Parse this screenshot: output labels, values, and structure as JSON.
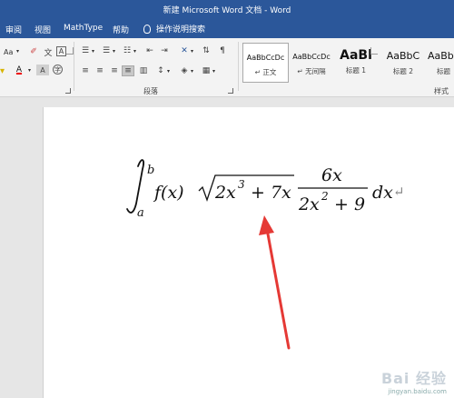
{
  "window": {
    "title": "新建 Microsoft Word 文档 - Word"
  },
  "tabs": [
    {
      "label": "审阅"
    },
    {
      "label": "视图"
    },
    {
      "label": "MathType"
    },
    {
      "label": "帮助"
    }
  ],
  "tell_me": {
    "label": "操作说明搜索"
  },
  "ribbon": {
    "font_group": {
      "font_size_label": "Aa",
      "wen_label": "文",
      "a_label": "A"
    },
    "paragraph_group": {
      "label": "段落"
    },
    "styles_group": {
      "label": "样式"
    },
    "styles": [
      {
        "sample": "AaBbCcDc",
        "name": "↵ 正文",
        "selected": true
      },
      {
        "sample": "AaBbCcDc",
        "name": "↵ 无间隔",
        "selected": false
      },
      {
        "sample": "AaBl",
        "name": "标题 1",
        "selected": false
      },
      {
        "sample": "AaBbC",
        "name": "标题 2",
        "selected": false
      },
      {
        "sample": "AaBb",
        "name": "标题",
        "selected": false
      }
    ]
  },
  "equation": {
    "integral_lower": "a",
    "integral_upper": "b",
    "fx": "f(x)",
    "radicand_2": "2",
    "radicand_x": "x",
    "radicand_exp": "3",
    "radicand_rest": "+ 7x",
    "numerator": "6x",
    "denominator_2": "2",
    "denominator_x": "x",
    "denominator_exp": "2",
    "denominator_rest": "+ 9",
    "dx": "dx",
    "paragraph_mark": "↵"
  },
  "annotation": {
    "arrow_color": "#e53935"
  },
  "watermark": {
    "logo": "Bai 经验",
    "url": "jingyan.baidu.com"
  },
  "colors": {
    "titlebar": "#2b579a",
    "ribbon": "#f3f3f3",
    "canvas": "#e6e6e6"
  }
}
